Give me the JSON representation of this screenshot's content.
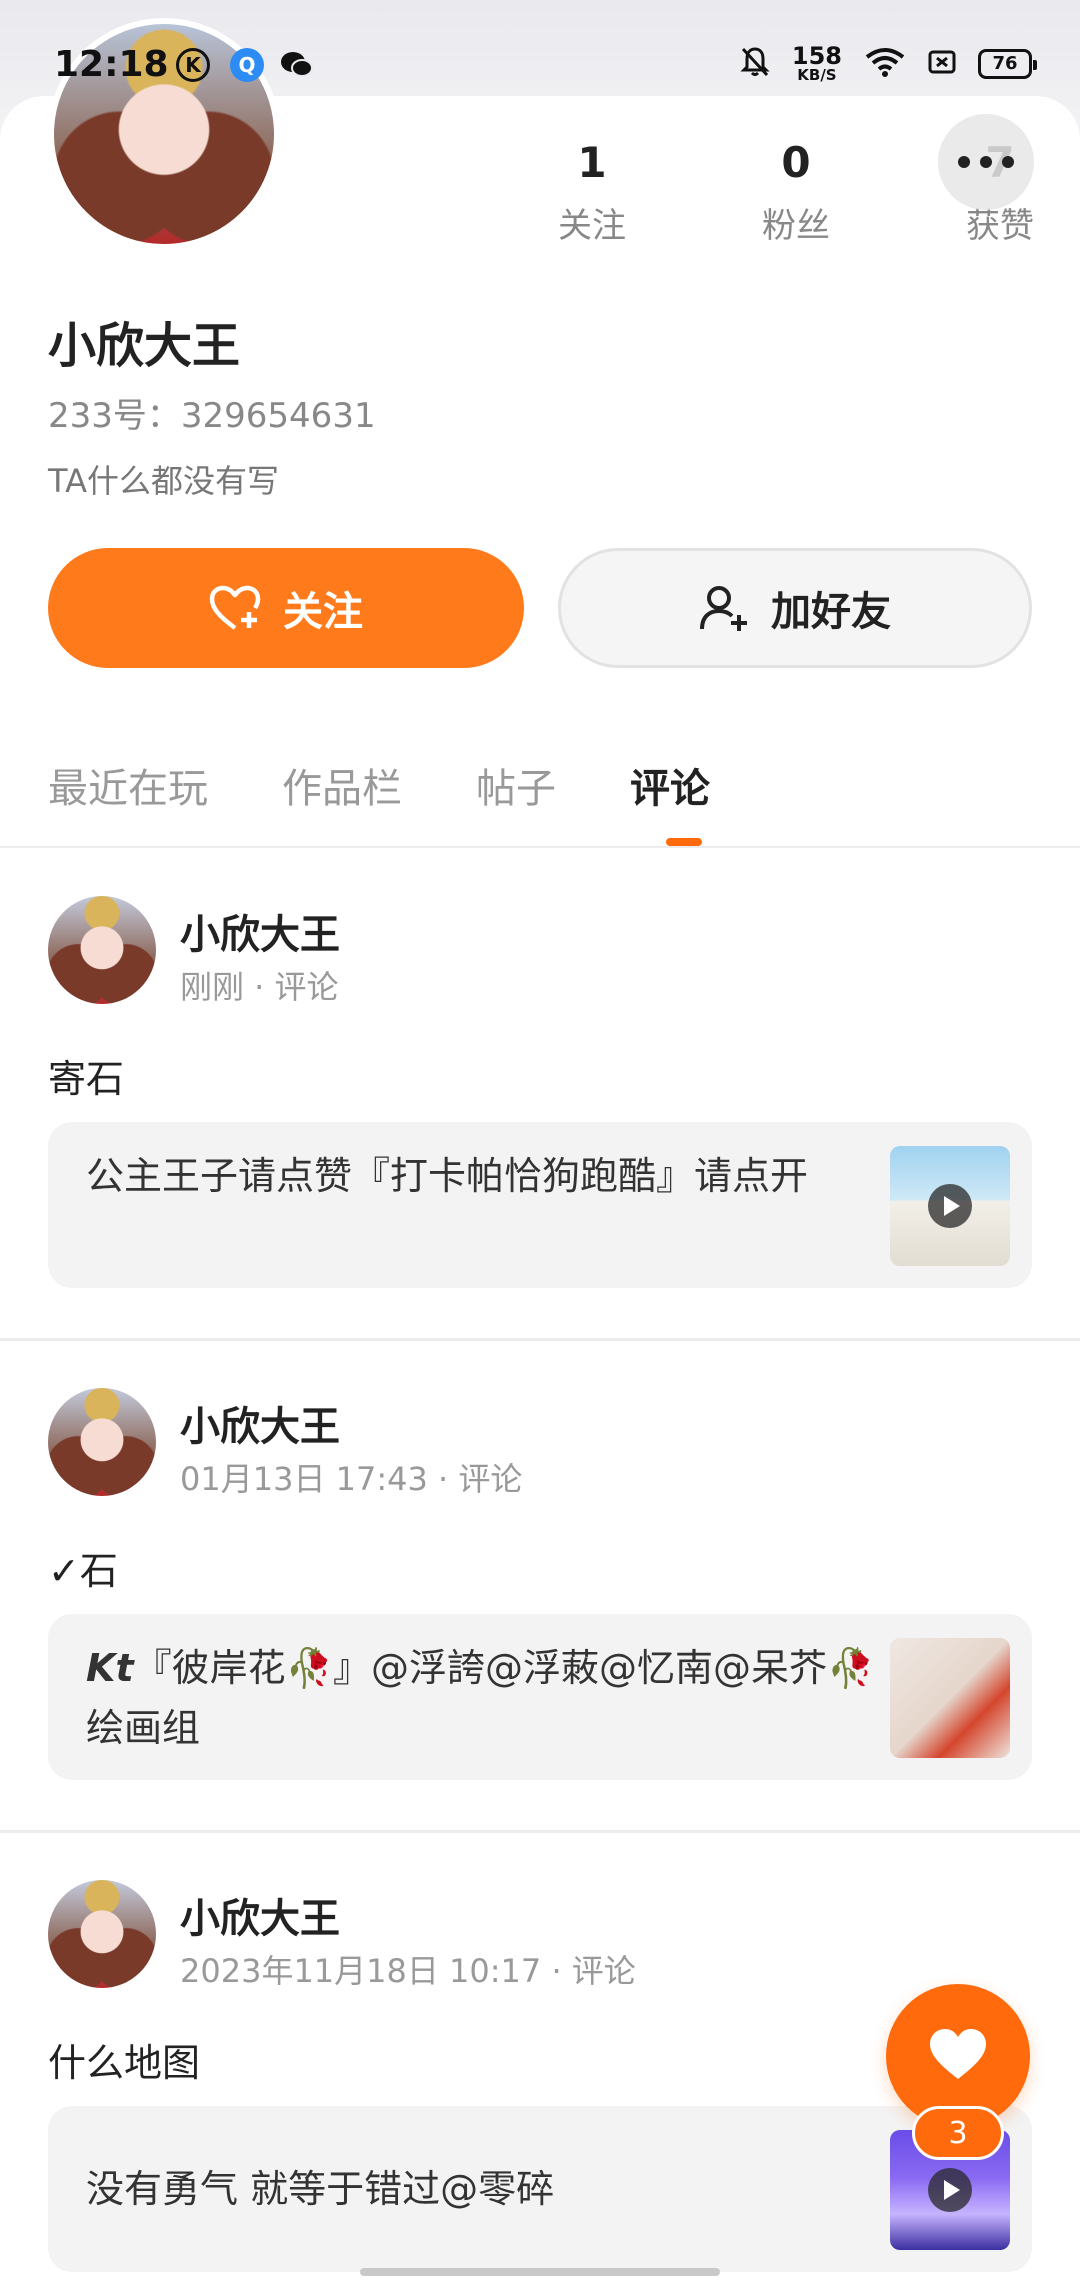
{
  "status_bar": {
    "time": "12:18",
    "icons": [
      "k-circle-icon",
      "qq-browser-icon",
      "wechat-icon",
      "mute-icon",
      "wifi-icon",
      "sim-icon"
    ],
    "net_speed": "158",
    "net_unit": "KB/S",
    "battery": "76"
  },
  "profile": {
    "name": "小欣大王",
    "uid": "233号：329654631",
    "bio": "TA什么都没有写",
    "stats": [
      {
        "num": "1",
        "label": "关注"
      },
      {
        "num": "0",
        "label": "粉丝"
      },
      {
        "num": "7",
        "label": "获赞"
      }
    ],
    "follow_label": "关注",
    "add_friend_label": "加好友"
  },
  "tabs": [
    {
      "label": "最近在玩",
      "active": false
    },
    {
      "label": "作品栏",
      "active": false
    },
    {
      "label": "帖子",
      "active": false
    },
    {
      "label": "评论",
      "active": true
    }
  ],
  "posts": [
    {
      "name": "小欣大王",
      "meta": "刚刚 · 评论",
      "text": "寄石",
      "quote": "公主王子请点赞『打卡帕恰狗跑酷』请点开",
      "quote_prefix": ""
    },
    {
      "name": "小欣大王",
      "meta": "01月13日 17:43 · 评论",
      "text": "✓石",
      "quote_prefix": "Kt",
      "quote": "『彼岸花🥀』@浮誇@浮蓛@忆南@呆芥🥀绘画组"
    },
    {
      "name": "小欣大王",
      "meta": "2023年11月18日 10:17 · 评论",
      "text": "什么地图",
      "quote_prefix": "",
      "quote": "没有勇气 就等于错过@零碎"
    }
  ],
  "like_fab": {
    "count": "3"
  },
  "colors": {
    "accent": "#ff7a1a",
    "indicator": "#ff6a0c"
  }
}
